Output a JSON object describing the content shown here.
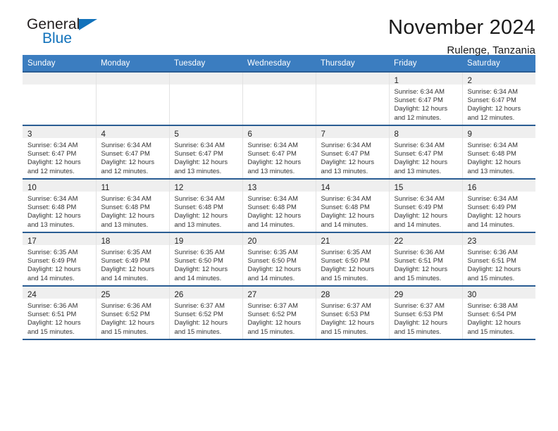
{
  "brand": {
    "name_part1": "General",
    "name_part2": "Blue",
    "triangle_color": "#1272bb"
  },
  "header": {
    "title": "November 2024",
    "subtitle": "Rulenge, Tanzania"
  },
  "colors": {
    "header_row_background": "#3b7dc0",
    "header_row_text": "#ffffff",
    "week_divider": "#2a5d93",
    "day_number_band": "#efefef",
    "brand_blue": "#1272bb"
  },
  "weekday_headers": [
    "Sunday",
    "Monday",
    "Tuesday",
    "Wednesday",
    "Thursday",
    "Friday",
    "Saturday"
  ],
  "weeks": [
    [
      {
        "empty": true
      },
      {
        "empty": true
      },
      {
        "empty": true
      },
      {
        "empty": true
      },
      {
        "empty": true
      },
      {
        "day": "1",
        "sunrise": "Sunrise: 6:34 AM",
        "sunset": "Sunset: 6:47 PM",
        "daylight_line1": "Daylight: 12 hours",
        "daylight_line2": "and 12 minutes."
      },
      {
        "day": "2",
        "sunrise": "Sunrise: 6:34 AM",
        "sunset": "Sunset: 6:47 PM",
        "daylight_line1": "Daylight: 12 hours",
        "daylight_line2": "and 12 minutes."
      }
    ],
    [
      {
        "day": "3",
        "sunrise": "Sunrise: 6:34 AM",
        "sunset": "Sunset: 6:47 PM",
        "daylight_line1": "Daylight: 12 hours",
        "daylight_line2": "and 12 minutes."
      },
      {
        "day": "4",
        "sunrise": "Sunrise: 6:34 AM",
        "sunset": "Sunset: 6:47 PM",
        "daylight_line1": "Daylight: 12 hours",
        "daylight_line2": "and 12 minutes."
      },
      {
        "day": "5",
        "sunrise": "Sunrise: 6:34 AM",
        "sunset": "Sunset: 6:47 PM",
        "daylight_line1": "Daylight: 12 hours",
        "daylight_line2": "and 13 minutes."
      },
      {
        "day": "6",
        "sunrise": "Sunrise: 6:34 AM",
        "sunset": "Sunset: 6:47 PM",
        "daylight_line1": "Daylight: 12 hours",
        "daylight_line2": "and 13 minutes."
      },
      {
        "day": "7",
        "sunrise": "Sunrise: 6:34 AM",
        "sunset": "Sunset: 6:47 PM",
        "daylight_line1": "Daylight: 12 hours",
        "daylight_line2": "and 13 minutes."
      },
      {
        "day": "8",
        "sunrise": "Sunrise: 6:34 AM",
        "sunset": "Sunset: 6:47 PM",
        "daylight_line1": "Daylight: 12 hours",
        "daylight_line2": "and 13 minutes."
      },
      {
        "day": "9",
        "sunrise": "Sunrise: 6:34 AM",
        "sunset": "Sunset: 6:48 PM",
        "daylight_line1": "Daylight: 12 hours",
        "daylight_line2": "and 13 minutes."
      }
    ],
    [
      {
        "day": "10",
        "sunrise": "Sunrise: 6:34 AM",
        "sunset": "Sunset: 6:48 PM",
        "daylight_line1": "Daylight: 12 hours",
        "daylight_line2": "and 13 minutes."
      },
      {
        "day": "11",
        "sunrise": "Sunrise: 6:34 AM",
        "sunset": "Sunset: 6:48 PM",
        "daylight_line1": "Daylight: 12 hours",
        "daylight_line2": "and 13 minutes."
      },
      {
        "day": "12",
        "sunrise": "Sunrise: 6:34 AM",
        "sunset": "Sunset: 6:48 PM",
        "daylight_line1": "Daylight: 12 hours",
        "daylight_line2": "and 13 minutes."
      },
      {
        "day": "13",
        "sunrise": "Sunrise: 6:34 AM",
        "sunset": "Sunset: 6:48 PM",
        "daylight_line1": "Daylight: 12 hours",
        "daylight_line2": "and 14 minutes."
      },
      {
        "day": "14",
        "sunrise": "Sunrise: 6:34 AM",
        "sunset": "Sunset: 6:48 PM",
        "daylight_line1": "Daylight: 12 hours",
        "daylight_line2": "and 14 minutes."
      },
      {
        "day": "15",
        "sunrise": "Sunrise: 6:34 AM",
        "sunset": "Sunset: 6:49 PM",
        "daylight_line1": "Daylight: 12 hours",
        "daylight_line2": "and 14 minutes."
      },
      {
        "day": "16",
        "sunrise": "Sunrise: 6:34 AM",
        "sunset": "Sunset: 6:49 PM",
        "daylight_line1": "Daylight: 12 hours",
        "daylight_line2": "and 14 minutes."
      }
    ],
    [
      {
        "day": "17",
        "sunrise": "Sunrise: 6:35 AM",
        "sunset": "Sunset: 6:49 PM",
        "daylight_line1": "Daylight: 12 hours",
        "daylight_line2": "and 14 minutes."
      },
      {
        "day": "18",
        "sunrise": "Sunrise: 6:35 AM",
        "sunset": "Sunset: 6:49 PM",
        "daylight_line1": "Daylight: 12 hours",
        "daylight_line2": "and 14 minutes."
      },
      {
        "day": "19",
        "sunrise": "Sunrise: 6:35 AM",
        "sunset": "Sunset: 6:50 PM",
        "daylight_line1": "Daylight: 12 hours",
        "daylight_line2": "and 14 minutes."
      },
      {
        "day": "20",
        "sunrise": "Sunrise: 6:35 AM",
        "sunset": "Sunset: 6:50 PM",
        "daylight_line1": "Daylight: 12 hours",
        "daylight_line2": "and 14 minutes."
      },
      {
        "day": "21",
        "sunrise": "Sunrise: 6:35 AM",
        "sunset": "Sunset: 6:50 PM",
        "daylight_line1": "Daylight: 12 hours",
        "daylight_line2": "and 15 minutes."
      },
      {
        "day": "22",
        "sunrise": "Sunrise: 6:36 AM",
        "sunset": "Sunset: 6:51 PM",
        "daylight_line1": "Daylight: 12 hours",
        "daylight_line2": "and 15 minutes."
      },
      {
        "day": "23",
        "sunrise": "Sunrise: 6:36 AM",
        "sunset": "Sunset: 6:51 PM",
        "daylight_line1": "Daylight: 12 hours",
        "daylight_line2": "and 15 minutes."
      }
    ],
    [
      {
        "day": "24",
        "sunrise": "Sunrise: 6:36 AM",
        "sunset": "Sunset: 6:51 PM",
        "daylight_line1": "Daylight: 12 hours",
        "daylight_line2": "and 15 minutes."
      },
      {
        "day": "25",
        "sunrise": "Sunrise: 6:36 AM",
        "sunset": "Sunset: 6:52 PM",
        "daylight_line1": "Daylight: 12 hours",
        "daylight_line2": "and 15 minutes."
      },
      {
        "day": "26",
        "sunrise": "Sunrise: 6:37 AM",
        "sunset": "Sunset: 6:52 PM",
        "daylight_line1": "Daylight: 12 hours",
        "daylight_line2": "and 15 minutes."
      },
      {
        "day": "27",
        "sunrise": "Sunrise: 6:37 AM",
        "sunset": "Sunset: 6:52 PM",
        "daylight_line1": "Daylight: 12 hours",
        "daylight_line2": "and 15 minutes."
      },
      {
        "day": "28",
        "sunrise": "Sunrise: 6:37 AM",
        "sunset": "Sunset: 6:53 PM",
        "daylight_line1": "Daylight: 12 hours",
        "daylight_line2": "and 15 minutes."
      },
      {
        "day": "29",
        "sunrise": "Sunrise: 6:37 AM",
        "sunset": "Sunset: 6:53 PM",
        "daylight_line1": "Daylight: 12 hours",
        "daylight_line2": "and 15 minutes."
      },
      {
        "day": "30",
        "sunrise": "Sunrise: 6:38 AM",
        "sunset": "Sunset: 6:54 PM",
        "daylight_line1": "Daylight: 12 hours",
        "daylight_line2": "and 15 minutes."
      }
    ]
  ]
}
